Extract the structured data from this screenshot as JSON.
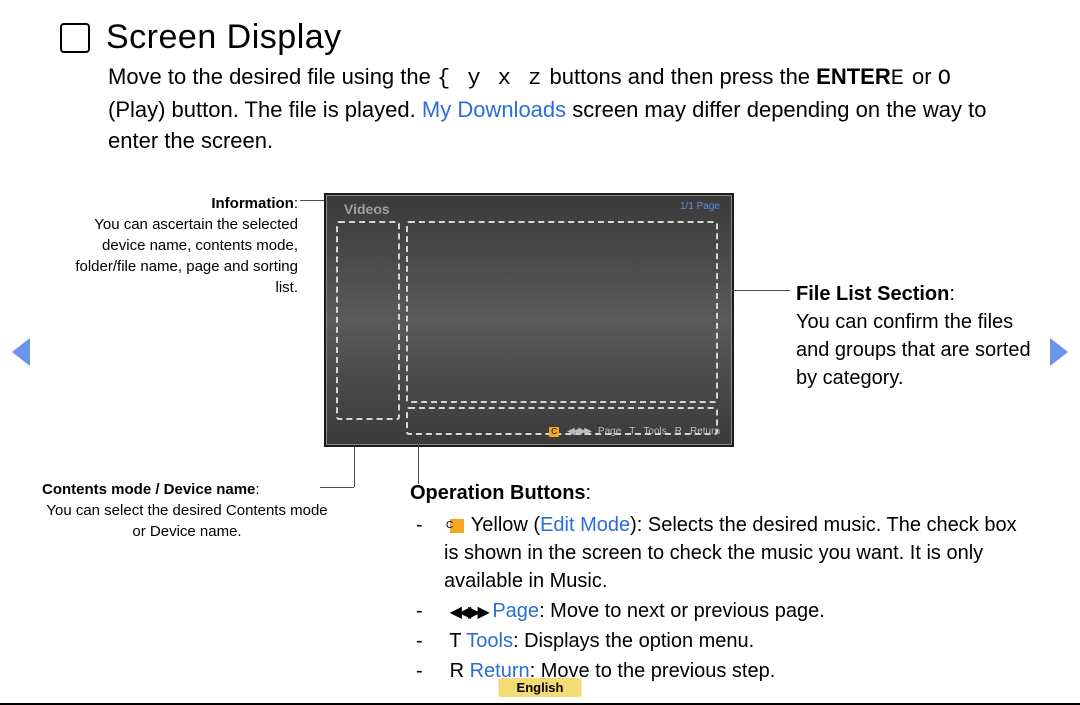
{
  "title": "Screen Display",
  "intro": {
    "pre": "Move to the desired file using the ",
    "buttons": "{  y  x  z",
    "mid1": " buttons and then press the ",
    "enterLabel": "ENTER",
    "enterGlyph": "E",
    "or": " or ",
    "playGlyph": "O",
    "mid2": " (Play) button. The file is played. ",
    "myDownloads": "My Downloads",
    "post": " screen may differ depending on the way to enter the screen."
  },
  "information": {
    "heading": "Information",
    "body": "You can ascertain the selected device name, contents mode, folder/file name, page and sorting list."
  },
  "contentsMode": {
    "heading": "Contents mode / Device name",
    "body": "You can select the desired Contents mode or Device name."
  },
  "mock": {
    "title": "Videos",
    "page": "1/1 Page",
    "footer": {
      "c": "C",
      "page": "Page",
      "toolsKey": "T",
      "tools": "Tools",
      "returnKey": "R",
      "ret": "Return"
    }
  },
  "fileList": {
    "heading": "File List Section",
    "body": "You can confirm the files and groups that are sorted by category."
  },
  "operation": {
    "heading": "Operation Buttons",
    "items": {
      "yellow": {
        "pre": "",
        "label": "Yellow (",
        "mode": "Edit Mode",
        "post": "): Selects the desired music. The check box is shown in the screen to check the music you want. It is only available in Music."
      },
      "page": {
        "icons": "◀◀▶▶",
        "name": "Page",
        "post": ": Move to next or previous page."
      },
      "tools": {
        "key": "T",
        "name": "Tools",
        "post": ": Displays the option menu."
      },
      "ret": {
        "key": "R",
        "name": "Return",
        "post": ": Move to the previous step."
      }
    }
  },
  "footer": "English"
}
